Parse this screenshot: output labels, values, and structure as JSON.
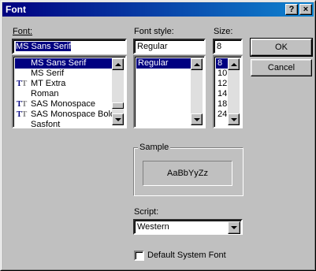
{
  "window": {
    "title": "Font",
    "help_label": "?",
    "close_label": "×"
  },
  "font": {
    "label": "Font:",
    "value": "MS Sans Serif",
    "items": [
      {
        "label": "MS Sans Serif",
        "truetype": false,
        "selected": true
      },
      {
        "label": "MS Serif",
        "truetype": false,
        "selected": false
      },
      {
        "label": "MT Extra",
        "truetype": true,
        "selected": false
      },
      {
        "label": "Roman",
        "truetype": false,
        "selected": false
      },
      {
        "label": "SAS Monospace",
        "truetype": true,
        "selected": false
      },
      {
        "label": "SAS Monospace Bold",
        "truetype": true,
        "selected": false
      },
      {
        "label": "Sasfont",
        "truetype": false,
        "selected": false
      }
    ]
  },
  "style": {
    "label": "Font style:",
    "value": "Regular",
    "items": [
      {
        "label": "Regular",
        "selected": true
      }
    ]
  },
  "size": {
    "label": "Size:",
    "value": "8",
    "items": [
      {
        "label": "8",
        "selected": true
      },
      {
        "label": "10",
        "selected": false
      },
      {
        "label": "12",
        "selected": false
      },
      {
        "label": "14",
        "selected": false
      },
      {
        "label": "18",
        "selected": false
      },
      {
        "label": "24",
        "selected": false
      }
    ]
  },
  "buttons": {
    "ok": "OK",
    "cancel": "Cancel"
  },
  "sample": {
    "label": "Sample",
    "text": "AaBbYyZz"
  },
  "script": {
    "label": "Script:",
    "value": "Western"
  },
  "default_font": {
    "label": "Default System Font",
    "checked": false
  },
  "colors": {
    "title_start": "#000080",
    "title_end": "#1084d0",
    "face": "#c0c0c0",
    "selection": "#000080"
  }
}
